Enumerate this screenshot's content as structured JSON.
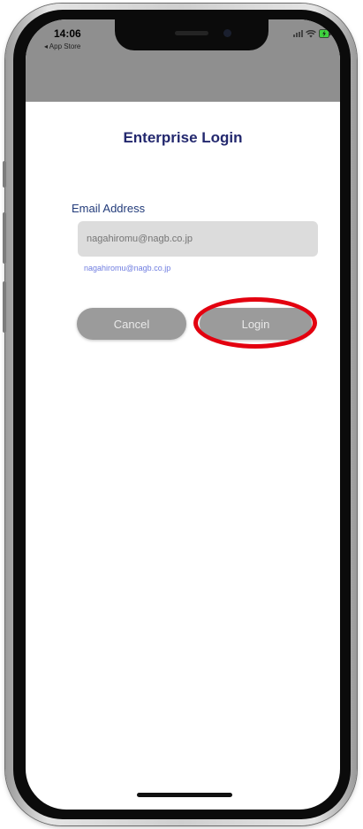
{
  "status_bar": {
    "time": "14:06",
    "back_label": "◂ App Store",
    "icons": [
      "signal-icon",
      "wifi-icon",
      "battery-icon"
    ]
  },
  "page": {
    "title": "Enterprise Login"
  },
  "email": {
    "label": "Email Address",
    "value": "",
    "placeholder": "nagahiromu@nagb.co.jp",
    "hint": "nagahiromu@nagb.co.jp"
  },
  "buttons": {
    "cancel_label": "Cancel",
    "login_label": "Login"
  },
  "colors": {
    "title": "#23286e",
    "label": "#223b7a",
    "hint": "#6f7de0",
    "button_bg": "#9b9b9b",
    "annotation": "#e3000f"
  }
}
